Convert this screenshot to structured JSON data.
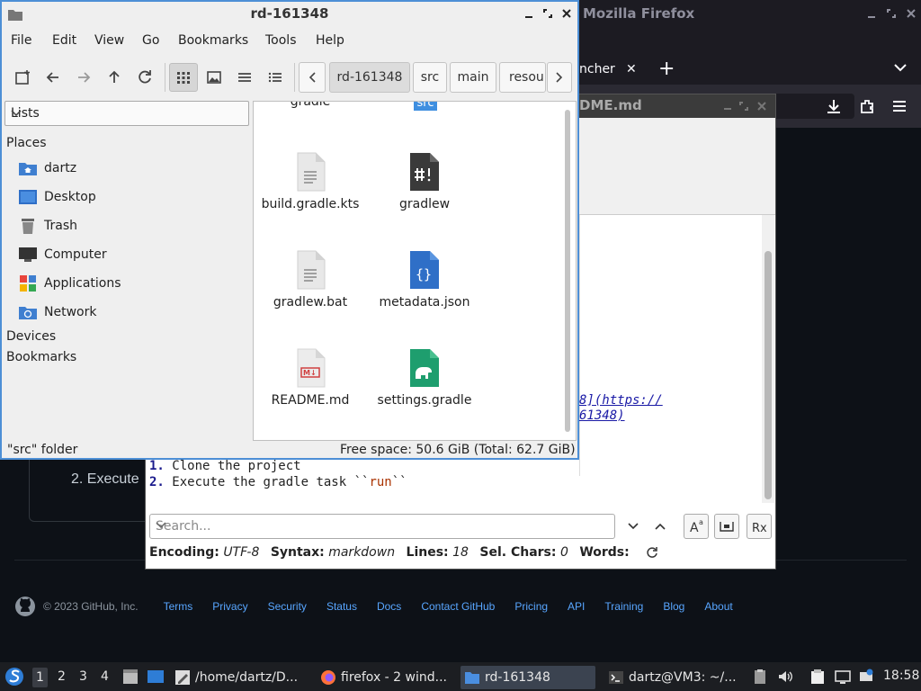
{
  "firefox": {
    "title": "Mozilla Firefox",
    "tab_label": "ncher",
    "tab_close": "✕",
    "new_tab": "+"
  },
  "editor": {
    "title": "DME.md",
    "link_line1": "8](https://",
    "link_line2": "61348)",
    "lines": [
      {
        "num": "1.",
        "text": "Clone the project",
        "code": ""
      },
      {
        "num": "2.",
        "text": "Execute the gradle task ``",
        "code": "run",
        "tail": "``"
      }
    ],
    "search_placeholder": "Search...",
    "status": {
      "encoding_label": "Encoding:",
      "encoding": "UTF-8",
      "syntax_label": "Syntax:",
      "syntax": "markdown",
      "lines_label": "Lines:",
      "lines": "18",
      "sel_label": "Sel. Chars:",
      "sel": "0",
      "words_label": "Words:"
    }
  },
  "github": {
    "step2": "2. Execute",
    "copyright": "© 2023 GitHub, Inc.",
    "footer_links": [
      "Terms",
      "Privacy",
      "Security",
      "Status",
      "Docs",
      "Contact GitHub",
      "Pricing",
      "API",
      "Training",
      "Blog",
      "About"
    ]
  },
  "filemanager": {
    "title": "rd-161348",
    "menu": [
      "File",
      "Edit",
      "View",
      "Go",
      "Bookmarks",
      "Tools",
      "Help"
    ],
    "breadcrumbs": [
      "rd-161348",
      "src",
      "main",
      "resou"
    ],
    "sidebar_mode": "Lists",
    "sections": {
      "places": "Places",
      "devices": "Devices",
      "bookmarks": "Bookmarks"
    },
    "places": [
      {
        "label": "dartz",
        "icon": "home-folder-icon"
      },
      {
        "label": "Desktop",
        "icon": "desktop-icon"
      },
      {
        "label": "Trash",
        "icon": "trash-icon"
      },
      {
        "label": "Computer",
        "icon": "computer-icon"
      },
      {
        "label": "Applications",
        "icon": "applications-icon"
      },
      {
        "label": "Network",
        "icon": "network-icon"
      }
    ],
    "partial_items": [
      "gradle",
      "src"
    ],
    "files": [
      {
        "name": "build.gradle.kts",
        "icon": "text-file-icon"
      },
      {
        "name": "gradlew",
        "icon": "script-file-icon"
      },
      {
        "name": "gradlew.bat",
        "icon": "text-file-icon"
      },
      {
        "name": "metadata.json",
        "icon": "json-file-icon"
      },
      {
        "name": "README.md",
        "icon": "markdown-file-icon"
      },
      {
        "name": "settings.gradle",
        "icon": "gradle-file-icon"
      }
    ],
    "status_left": "\"src\" folder",
    "status_right": "Free space: 50.6 GiB (Total: 62.7 GiB)"
  },
  "taskbar": {
    "workspaces": [
      "1",
      "2",
      "3",
      "4"
    ],
    "tasks": [
      {
        "label": "/home/dartz/D...",
        "icon": "text-editor-icon"
      },
      {
        "label": "firefox - 2 wind...",
        "icon": "firefox-icon"
      },
      {
        "label": "rd-161348",
        "icon": "folder-icon"
      },
      {
        "label": "dartz@VM3: ~/...",
        "icon": "terminal-icon"
      }
    ],
    "clock": "18:58"
  },
  "colors": {
    "accent": "#4d8fd6",
    "github_link": "#58a6ff",
    "github_bg": "#0d1117"
  }
}
